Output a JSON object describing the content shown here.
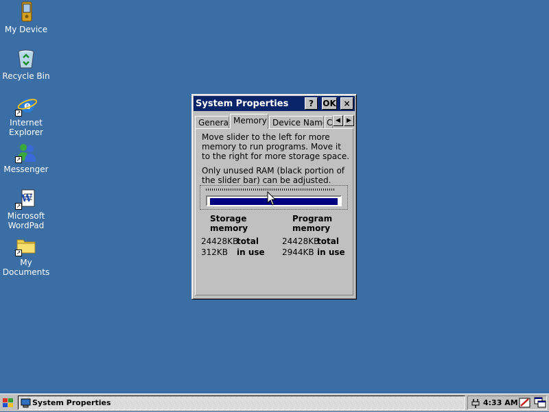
{
  "desktop": {
    "icons": [
      {
        "label": "My Device"
      },
      {
        "label": "Recycle Bin"
      },
      {
        "label": "Internet Explorer"
      },
      {
        "label": "Messenger"
      },
      {
        "label": "Microsoft WordPad"
      },
      {
        "label": "My Documents"
      }
    ]
  },
  "dialog": {
    "title": "System Properties",
    "help_label": "?",
    "ok_label": "OK",
    "close_label": "×",
    "tabs": [
      {
        "label": "General"
      },
      {
        "label": "Memory"
      },
      {
        "label": "Device Name"
      },
      {
        "label": "C"
      }
    ],
    "active_tab": "Memory",
    "description": "Move slider to the left for more memory to run programs. Move it to the right for more storage space.",
    "note": "Only unused RAM (black portion of the slider bar) can be adjusted.",
    "slider": {
      "storage_fraction": 0.5,
      "fill_color": "#000080"
    },
    "storage": {
      "heading": "Storage memory",
      "total_value": "24428KB",
      "total_label": "total",
      "in_use_value": "312KB",
      "in_use_label": "in use"
    },
    "program": {
      "heading": "Program memory",
      "total_value": "24428KB",
      "total_label": "total",
      "in_use_value": "2944KB",
      "in_use_label": "in use"
    }
  },
  "taskbar": {
    "task_label": "System Properties",
    "clock": "4:33 AM"
  },
  "colors": {
    "desktop": "#3a6ea5",
    "titlebar": "#0a246a"
  }
}
